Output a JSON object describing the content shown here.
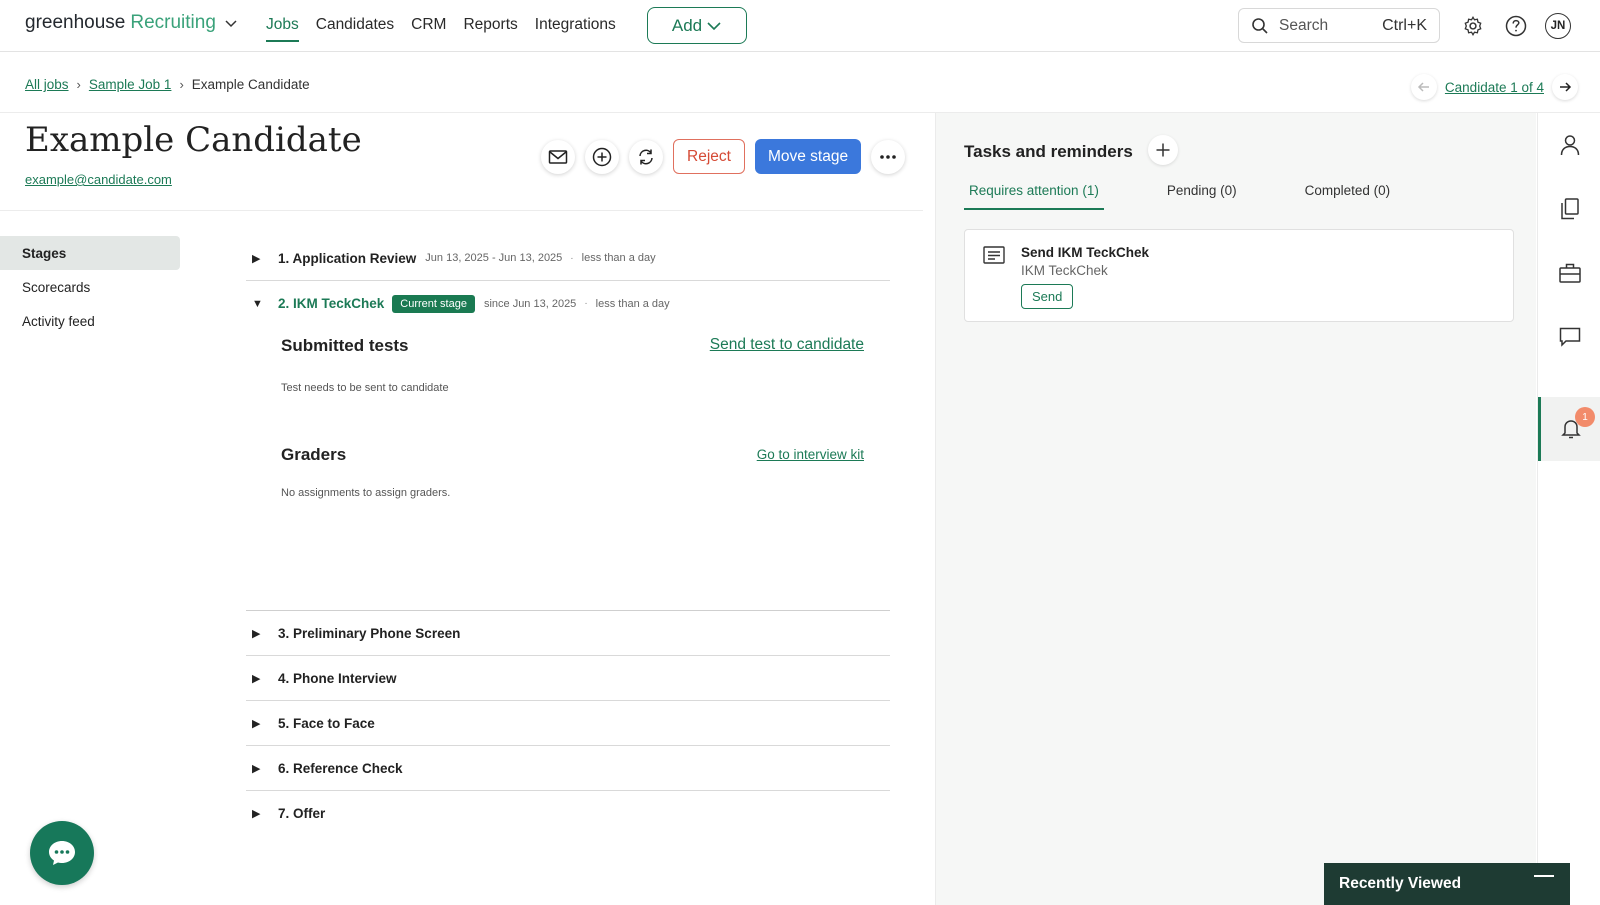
{
  "nav": {
    "logo_main": "greenhouse",
    "logo_product": "Recruiting",
    "links": [
      "Jobs",
      "Candidates",
      "CRM",
      "Reports",
      "Integrations"
    ],
    "add_label": "Add",
    "search_placeholder": "Search",
    "search_shortcut": "Ctrl+K",
    "avatar_initials": "JN"
  },
  "breadcrumb": {
    "all_jobs": "All jobs",
    "job": "Sample Job 1",
    "current": "Example Candidate",
    "candidate_position": "Candidate 1 of 4"
  },
  "candidate": {
    "name": "Example Candidate",
    "email": "example@candidate.com"
  },
  "actions": {
    "reject": "Reject",
    "move_stage": "Move stage"
  },
  "subnav": [
    "Stages",
    "Scorecards",
    "Activity feed"
  ],
  "stages": {
    "s1": {
      "name": "1. Application Review",
      "dates": "Jun 13, 2025 - Jun 13, 2025",
      "duration": "less than a day"
    },
    "s2": {
      "name": "2. IKM TeckChek",
      "badge": "Current stage",
      "since": "since Jun 13, 2025",
      "duration": "less than a day"
    },
    "others": [
      "3. Preliminary Phone Screen",
      "4. Phone Interview",
      "5. Face to Face",
      "6. Reference Check",
      "7. Offer"
    ]
  },
  "expanded": {
    "submitted_title": "Submitted tests",
    "submitted_link": "Send test to candidate",
    "submitted_note": "Test needs to be sent to candidate",
    "graders_title": "Graders",
    "graders_link": "Go to interview kit",
    "graders_note": "No assignments to assign graders."
  },
  "tasks": {
    "title": "Tasks and reminders",
    "tabs": [
      "Requires attention (1)",
      "Pending (0)",
      "Completed (0)"
    ],
    "card_title": "Send IKM TeckChek",
    "card_subtitle": "IKM TeckChek",
    "card_button": "Send"
  },
  "rail": {
    "notification_count": "1"
  },
  "recently_viewed": "Recently Viewed",
  "colors": {
    "brand_green": "#1c7a56",
    "primary_blue": "#3b78dc",
    "reject_red": "#d54a35"
  }
}
